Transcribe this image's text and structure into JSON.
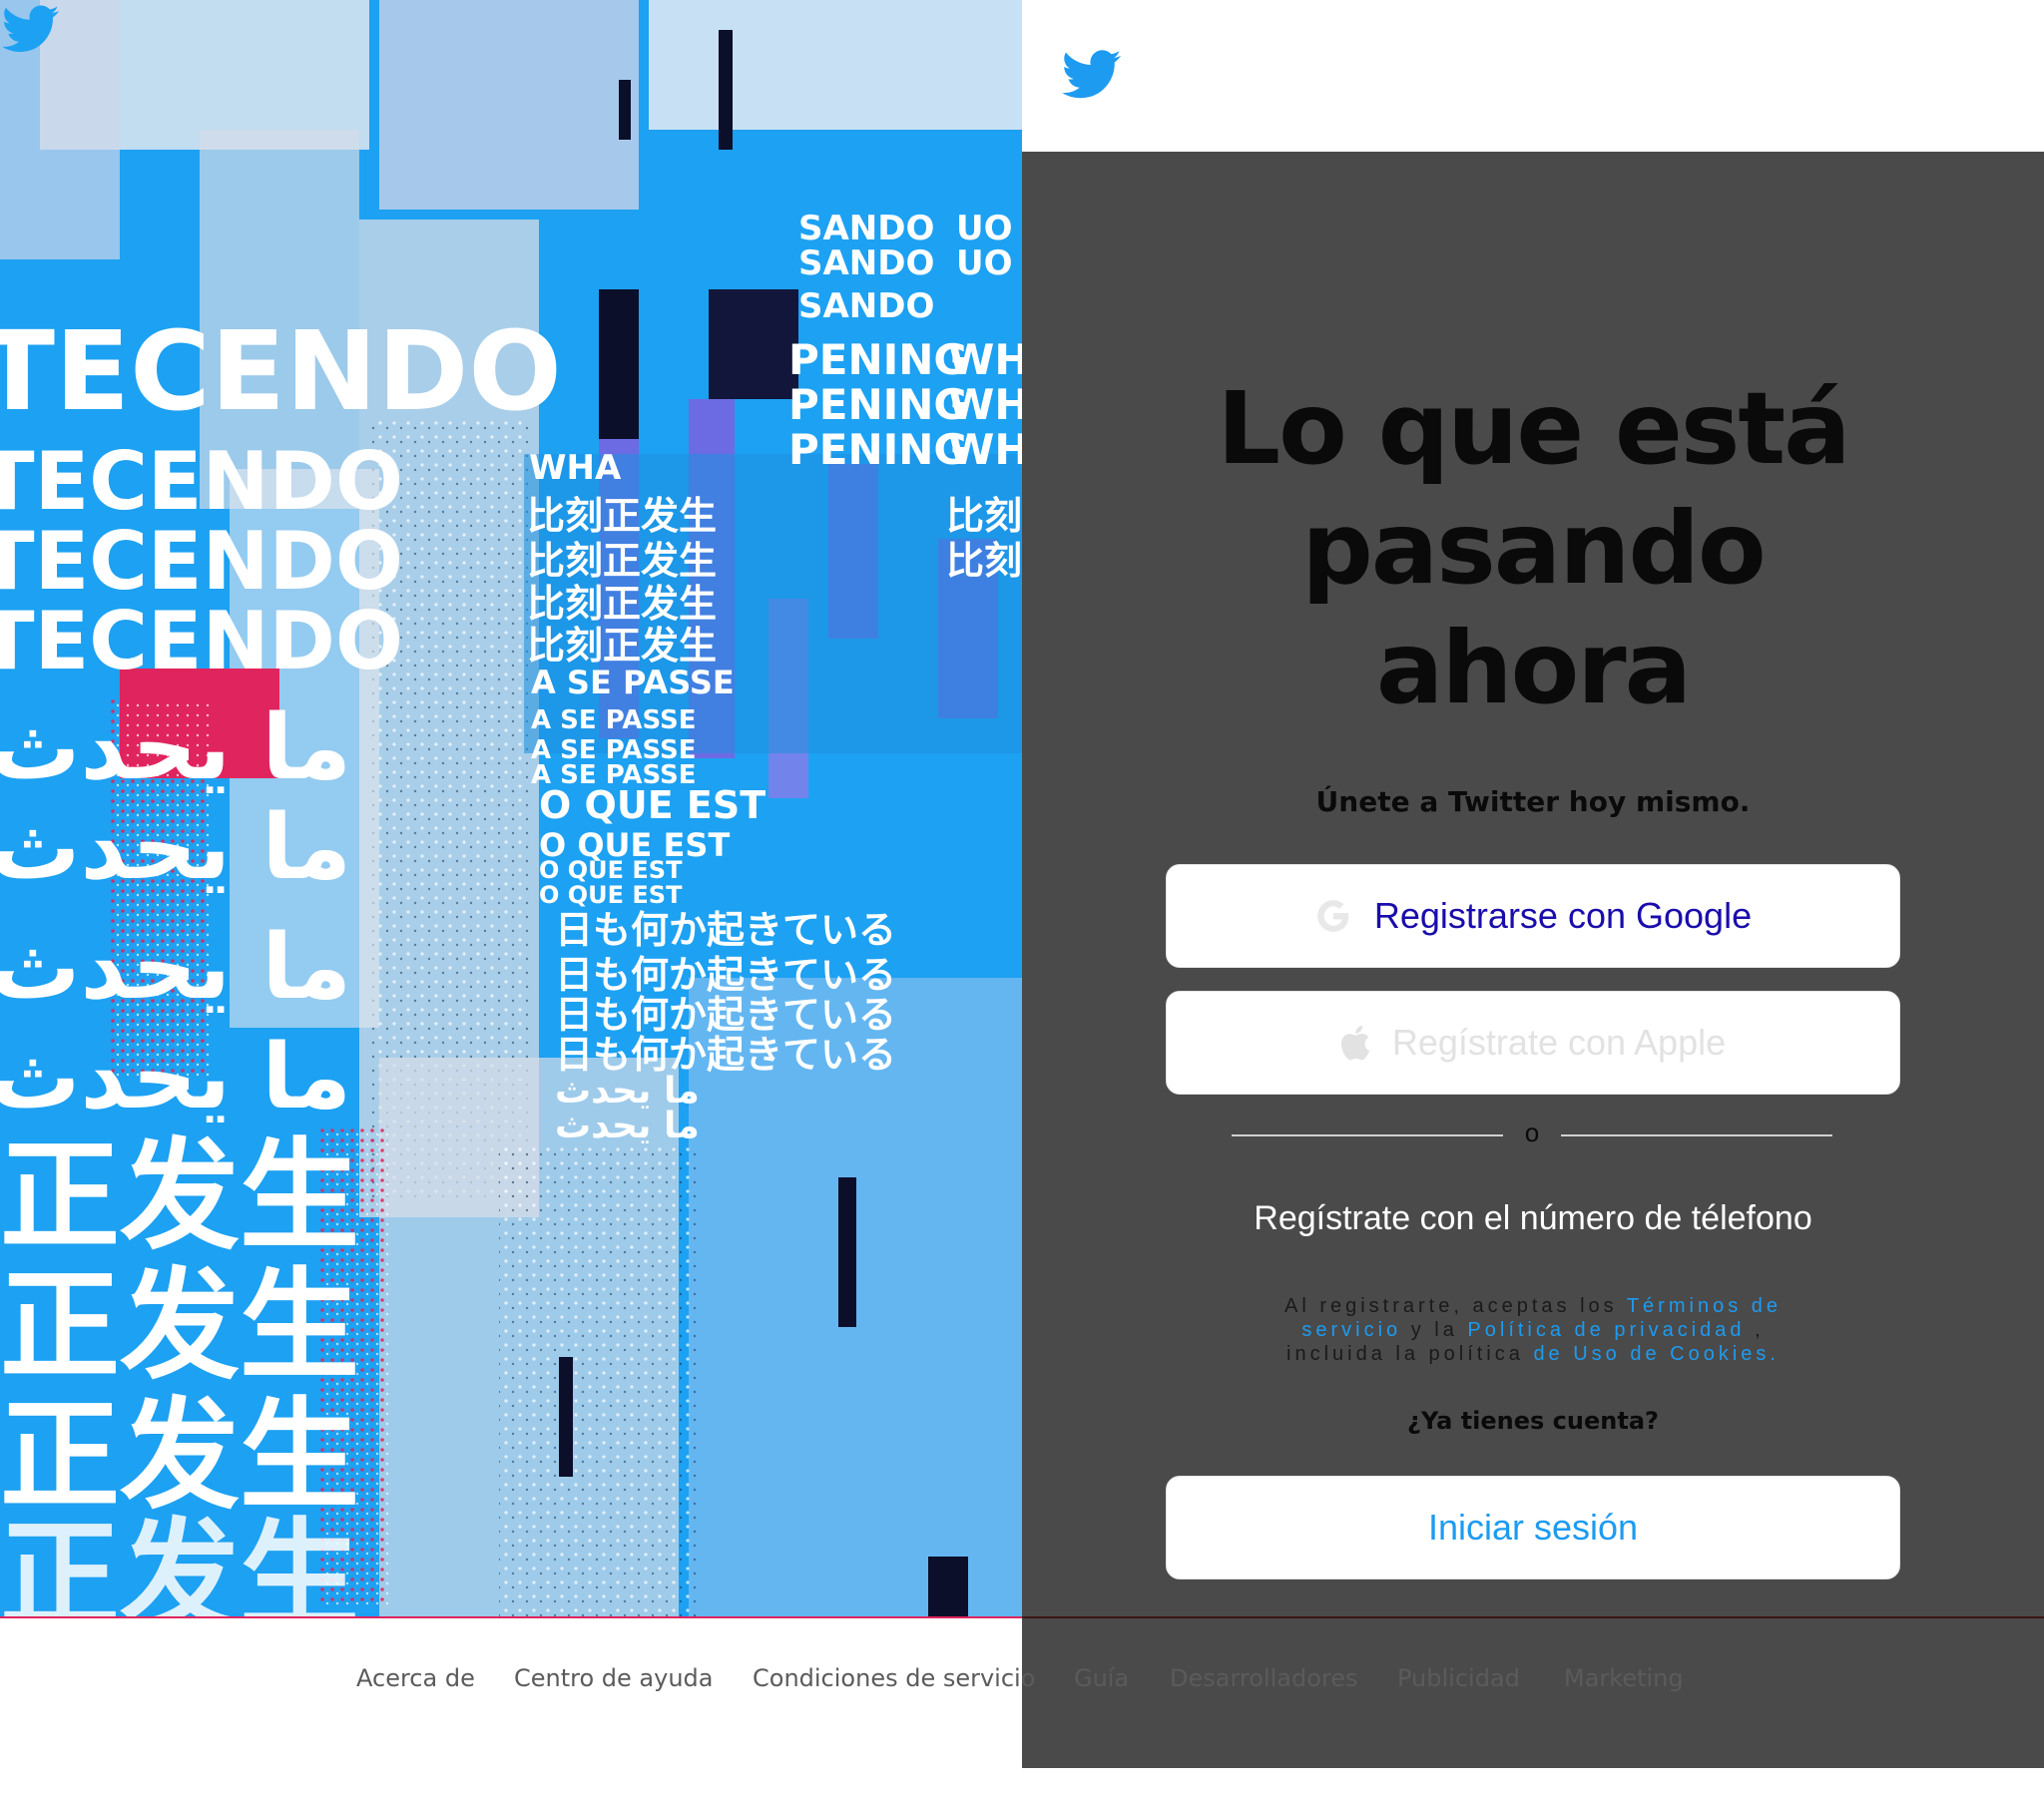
{
  "hero": {
    "art_texts": [
      "TECENDO",
      "TECENDO",
      "TECENDO",
      "TECENDO",
      "ما يحدث",
      "ما يحدث",
      "ما يحدث",
      "ما يحدث",
      "正发生",
      "正发生",
      "正发生",
      "正发生",
      "SANDO",
      "SANDO",
      "SANDO",
      "PENING",
      "PENING",
      "PENING",
      "WHA",
      "比刻正发生",
      "比刻正发生",
      "比刻正发生",
      "比刻正发生",
      "A SE PASSE",
      "A SE PASSE",
      "A SE PASSE",
      "A SE PASSE",
      "O QUE EST",
      "O QUE EST",
      "O QUE EST",
      "O QUE EST",
      "日も何か起きている",
      "日も何か起きている",
      "日も何か起きている",
      "日も何か起きている",
      "ما يحدث",
      "ما يحدث",
      "UO Q",
      "UO Q",
      "WHA",
      "WHA",
      "WHA",
      "比刻",
      "比刻"
    ]
  },
  "header": {
    "logo_icon": "twitter-bird-icon"
  },
  "signup": {
    "headline_1": "Lo que está",
    "headline_2": "pasando",
    "headline_3": "ahora",
    "join_text": "Únete a Twitter hoy mismo.",
    "google_label": "Registrarse con Google",
    "apple_label": "Regístrate con Apple",
    "or_text": "o",
    "phone_label": "Regístrate con el número de télefono",
    "terms_prefix": "Al registrarte, aceptas los",
    "terms_link": "Términos de servicio",
    "terms_mid": "y la",
    "privacy_link": "Política de privacidad",
    "terms_sep": ",",
    "terms_included": "incluida la política",
    "cookies_link": "de Uso de Cookies.",
    "have_account": "¿Ya tienes cuenta?",
    "login_label": "Iniciar sesión"
  },
  "footer": {
    "links": [
      "Acerca de",
      "Centro de ayuda",
      "Condiciones de servicio",
      "Guía",
      "Desarrolladores",
      "Publicidad",
      "Marketing"
    ]
  },
  "colors": {
    "brand_blue": "#1da1f2",
    "panel_bg": "#4a4a4a",
    "link_blue": "#1d9bf0",
    "accent_pink": "#e0245e",
    "accent_purple": "#7b61e0"
  }
}
